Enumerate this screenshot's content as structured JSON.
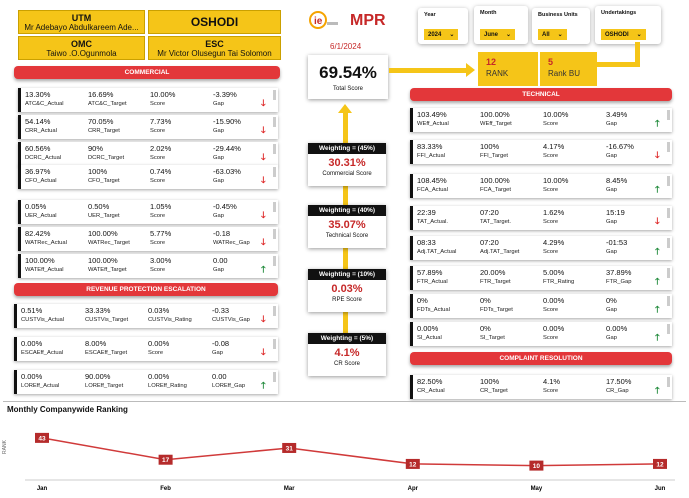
{
  "header": {
    "utm": {
      "title": "UTM",
      "name": "Mr Adebayo Abdulkareem Ade..."
    },
    "location": "OSHODI",
    "omc": {
      "title": "OMC",
      "name": "Taiwo .O.Ogunmola"
    },
    "esc": {
      "title": "ESC",
      "name": "Mr Victor Olusegun Tai Solomon"
    },
    "app_title": "MPR",
    "date": "6/1/2024"
  },
  "filters": [
    {
      "label": "Year",
      "value": "2024"
    },
    {
      "label": "Month",
      "value": "June"
    },
    {
      "label": "Business Units",
      "value": "All"
    },
    {
      "label": "Undertakings",
      "value": "OSHODI"
    }
  ],
  "total": {
    "value": "69.54%",
    "label": "Total Score"
  },
  "rank": {
    "value": "12",
    "label": "RANK"
  },
  "rank_bu": {
    "value": "5",
    "label": "Rank BU"
  },
  "weights": [
    {
      "tag": "Weighting = (45%)",
      "value": "30.31%",
      "label": "Commercial Score"
    },
    {
      "tag": "Weighting = (40%)",
      "value": "35.07%",
      "label": "Technical Score"
    },
    {
      "tag": "Weighting = (10%)",
      "value": "0.03%",
      "label": "RPE Score"
    },
    {
      "tag": "Weighting = (5%)",
      "value": "4.1%",
      "label": "CR Score"
    }
  ],
  "sections": {
    "commercial": "COMMERCIAL",
    "revenue": "REVENUE PROTECTION ESCALATION",
    "technical": "TECHNICAL",
    "complaint": "COMPLAINT RESOLUTION"
  },
  "commercial": [
    {
      "v": [
        "13.30%",
        "16.69%",
        "10.00%",
        "-3.39%"
      ],
      "l": [
        "ATC&C_Actual",
        "ATC&C_Target",
        "Score",
        "Gap"
      ],
      "dir": "down"
    },
    {
      "v": [
        "54.14%",
        "70.05%",
        "7.73%",
        "-15.90%"
      ],
      "l": [
        "CRR_Actual",
        "CRR_Target",
        "Score",
        "Gap"
      ],
      "dir": "down"
    },
    {
      "v": [
        "60.56%",
        "90%",
        "2.02%",
        "-29.44%"
      ],
      "l": [
        "DCRC_Actual",
        "DCRC_Target",
        "Score",
        "Gap"
      ],
      "dir": "down"
    },
    {
      "v": [
        "36.97%",
        "100%",
        "0.74%",
        "-63.03%"
      ],
      "l": [
        "CFO_Actual",
        "CFO_Target",
        "Score",
        "Gap"
      ],
      "dir": "down"
    },
    {
      "v": [
        "0.05%",
        "0.50%",
        "1.05%",
        "-0.45%"
      ],
      "l": [
        "UER_Actual",
        "UER_Target",
        "Score",
        "Gap"
      ],
      "dir": "down"
    },
    {
      "v": [
        "82.42%",
        "100.00%",
        "5.77%",
        "-0.18"
      ],
      "l": [
        "WATRec_Actual",
        "WATRec_Target",
        "Score",
        "WATRec_Gap"
      ],
      "dir": "down"
    },
    {
      "v": [
        "100.00%",
        "100.00%",
        "3.00%",
        "0.00"
      ],
      "l": [
        "WATEff_Actual",
        "WATEff_Target",
        "Score",
        "Gap"
      ],
      "dir": "up"
    }
  ],
  "revenue": [
    {
      "v": [
        "0.51%",
        "33.33%",
        "0.03%",
        "-0.33"
      ],
      "l": [
        "CUSTVis_Actual",
        "CUSTVis_Target",
        "CUSTVis_Rating",
        "CUSTVis_Gap"
      ],
      "dir": "down"
    },
    {
      "v": [
        "0.00%",
        "8.00%",
        "0.00%",
        "-0.08"
      ],
      "l": [
        "ESCAEff_Actual",
        "ESCAEff_Target",
        "Score",
        "Gap"
      ],
      "dir": "down"
    },
    {
      "v": [
        "0.00%",
        "90.00%",
        "0.00%",
        "0.00"
      ],
      "l": [
        "LOREff_Actual",
        "LOREff_Target",
        "LOREff_Rating",
        "LOREff_Gap"
      ],
      "dir": "up"
    }
  ],
  "technical": [
    {
      "v": [
        "103.49%",
        "100.00%",
        "10.00%",
        "3.49%"
      ],
      "l": [
        "WEff_Actual",
        "WEff_Target",
        "Score",
        "Gap"
      ],
      "dir": "up"
    },
    {
      "v": [
        "83.33%",
        "100%",
        "4.17%",
        "-16.67%"
      ],
      "l": [
        "FFI_Actual",
        "FFI_Target",
        "Score",
        "Gap"
      ],
      "dir": "down"
    },
    {
      "v": [
        "108.45%",
        "100.00%",
        "10.00%",
        "8.45%"
      ],
      "l": [
        "FCA_Actual",
        "FCA_Target",
        "Score",
        "Gap"
      ],
      "dir": "up"
    },
    {
      "v": [
        "22:39",
        "07:20",
        "1.62%",
        "15:19"
      ],
      "l": [
        "TAT_Actual.",
        "TAT_Target.",
        "Score",
        "Gap"
      ],
      "dir": "down"
    },
    {
      "v": [
        "08:33",
        "07:20",
        "4.29%",
        "-01:53"
      ],
      "l": [
        "Adj.TAT_Actual",
        "Adj.TAT_Target",
        "Score",
        "Gap"
      ],
      "dir": "up"
    },
    {
      "v": [
        "57.89%",
        "20.00%",
        "5.00%",
        "37.89%"
      ],
      "l": [
        "FTR_Actual",
        "FTR_Target",
        "FTR_Rating",
        "FTR_Gap"
      ],
      "dir": "up"
    },
    {
      "v": [
        "0%",
        "0%",
        "0.00%",
        "0%"
      ],
      "l": [
        "FDTs_Actual",
        "FDTs_Target",
        "Score",
        "Gap"
      ],
      "dir": "up"
    },
    {
      "v": [
        "0.00%",
        "0%",
        "0.00%",
        "0.00%"
      ],
      "l": [
        "SI_Actual",
        "SI_Target",
        "Score",
        "Gap"
      ],
      "dir": "up"
    }
  ],
  "complaint": [
    {
      "v": [
        "82.50%",
        "100%",
        "4.1%",
        "17.50%"
      ],
      "l": [
        "CR_Actual",
        "CR_Target",
        "Score",
        "CR_Gap"
      ],
      "dir": "up"
    }
  ],
  "chart_data": {
    "type": "line",
    "title": "Monthly Companywide Ranking",
    "ylabel": "RANK",
    "categories": [
      "Jan",
      "Feb",
      "Mar",
      "Apr",
      "May",
      "Jun"
    ],
    "values": [
      43,
      17,
      31,
      12,
      10,
      12
    ],
    "ylim": [
      0,
      50
    ],
    "color": "#d03a3a"
  }
}
